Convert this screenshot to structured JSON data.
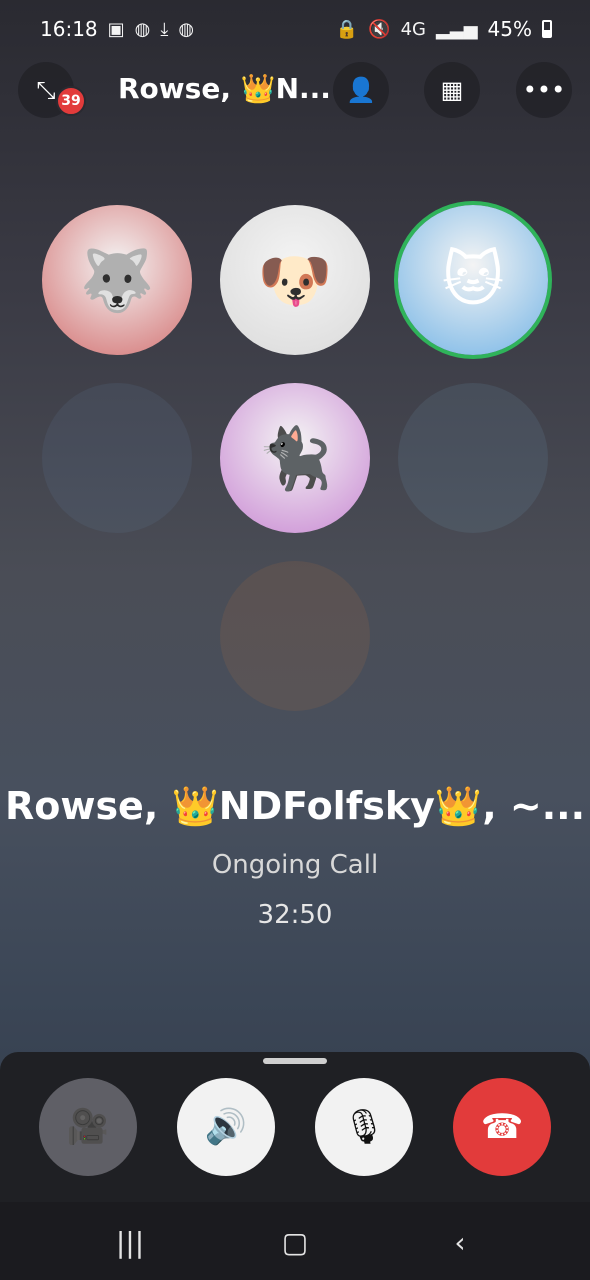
{
  "status_bar": {
    "time": "16:18",
    "network": "4G",
    "battery": "45%",
    "left_icons": [
      "twitch-icon",
      "discord-icon",
      "download-icon",
      "discord-icon"
    ],
    "right_icons": [
      "lock-icon",
      "mute-icon",
      "signal-icon",
      "battery-icon"
    ]
  },
  "topbar": {
    "title": "Rowse, 👑N...",
    "badge_count": "39"
  },
  "participants": [
    {
      "emoji": "🐺",
      "accent": "#c53b3b",
      "speaking": false
    },
    {
      "emoji": "🐶",
      "accent": "#cfcfcf",
      "speaking": false
    },
    {
      "emoji": "🐱",
      "accent": "#3f9ae0",
      "speaking": true
    },
    {
      "emoji": "🐈‍⬛",
      "accent": "#b75cc5",
      "speaking": false
    }
  ],
  "call": {
    "name": "Rowse, 👑NDFolfsky👑, ~...",
    "status": "Ongoing Call",
    "timer": "32:50"
  },
  "colors": {
    "hangup": "#e23b3b",
    "control_light": "#f2f2f2",
    "control_dark": "#5f5f66",
    "speaking_ring": "#2fb35a"
  }
}
